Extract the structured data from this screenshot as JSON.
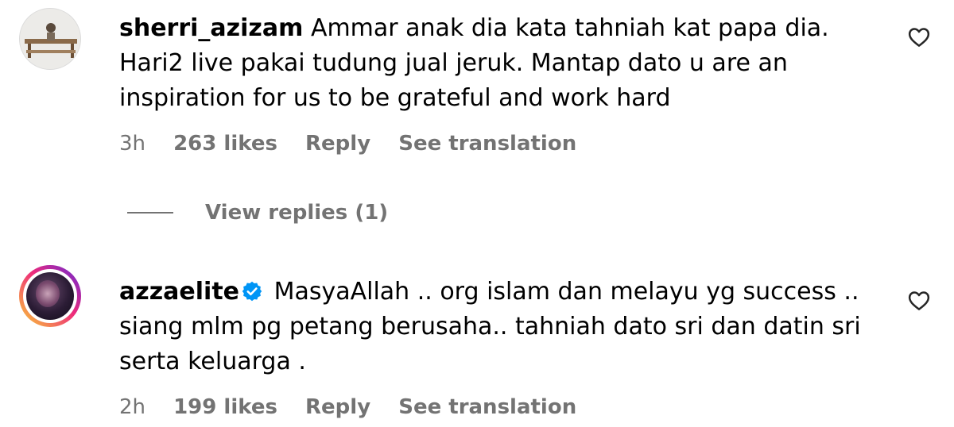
{
  "comments": [
    {
      "username": "sherri_azizam",
      "text": "Ammar anak dia kata tahniah kat papa dia. Hari2 live pakai tudung jual jeruk. Mantap dato u are an inspiration for us to be grateful and work hard",
      "time": "3h",
      "likes": "263 likes",
      "reply_label": "Reply",
      "translation_label": "See translation",
      "verified": false
    },
    {
      "username": "azzaelite",
      "text": "MasyaAllah .. org islam dan melayu yg success .. siang mlm pg petang berusaha.. tahniah dato sri dan datin sri serta keluarga .",
      "time": "2h",
      "likes": "199 likes",
      "reply_label": "Reply",
      "translation_label": "See translation",
      "verified": true
    }
  ],
  "view_replies": "View replies (1)",
  "colors": {
    "secondary_text": "#737373",
    "verified_badge": "#0095f6",
    "story_ring_start": "#f9ce34",
    "story_ring_end": "#6228d7"
  },
  "icons": [
    "heart-outline-icon",
    "verified-badge-icon"
  ]
}
